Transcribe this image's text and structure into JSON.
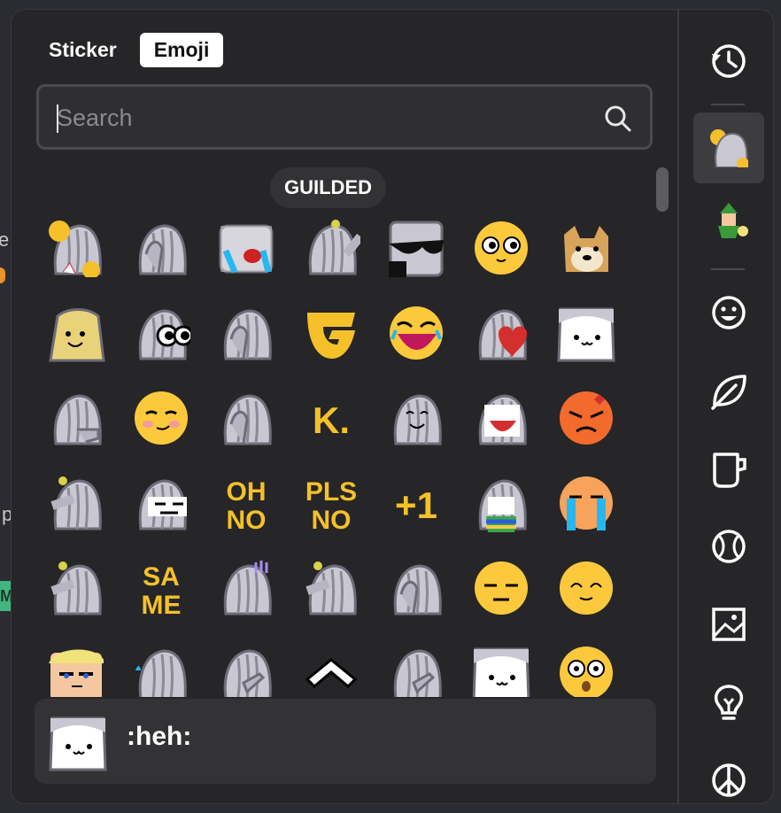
{
  "tabs": {
    "sticker": "Sticker",
    "emoji": "Emoji"
  },
  "search": {
    "placeholder": "Search"
  },
  "section": {
    "title": "GUILDED"
  },
  "preview": {
    "name": ":heh:"
  },
  "background": {
    "peek_letters": [
      "e",
      "p"
    ],
    "badge_letter": "M"
  },
  "rows": [
    [
      {
        "kind": "knight-pompom"
      },
      {
        "kind": "knight-facepalm"
      },
      {
        "kind": "knight-cry"
      },
      {
        "kind": "knight-dab"
      },
      {
        "kind": "knight-shades"
      },
      {
        "kind": "face-pleading"
      },
      {
        "kind": "doge"
      }
    ],
    [
      {
        "kind": "gold-smile"
      },
      {
        "kind": "knight-eyes"
      },
      {
        "kind": "knight-facepalm"
      },
      {
        "kind": "guilded-logo"
      },
      {
        "kind": "face-laugh"
      },
      {
        "kind": "knight-heart"
      },
      {
        "kind": "knight-heh"
      }
    ],
    [
      {
        "kind": "knight-think"
      },
      {
        "kind": "face-smug"
      },
      {
        "kind": "knight-facepalm"
      },
      {
        "kind": "text",
        "text": "K."
      },
      {
        "kind": "knight-smile"
      },
      {
        "kind": "knight-laugh"
      },
      {
        "kind": "face-angry"
      }
    ],
    [
      {
        "kind": "knight-salute"
      },
      {
        "kind": "knight-meh"
      },
      {
        "kind": "text",
        "text": "OH NO"
      },
      {
        "kind": "text",
        "text": "PLS NO"
      },
      {
        "kind": "text",
        "text": "+1"
      },
      {
        "kind": "knight-vomit"
      },
      {
        "kind": "face-sob"
      }
    ],
    [
      {
        "kind": "knight-salute"
      },
      {
        "kind": "text",
        "text": "SA ME"
      },
      {
        "kind": "knight-sweat"
      },
      {
        "kind": "knight-salute"
      },
      {
        "kind": "knight-facepalm"
      },
      {
        "kind": "face-unamused"
      },
      {
        "kind": "face-content"
      }
    ],
    [
      {
        "kind": "blonde-face"
      },
      {
        "kind": "knight-nervous"
      },
      {
        "kind": "knight-point"
      },
      {
        "kind": "chevron"
      },
      {
        "kind": "knight-point"
      },
      {
        "kind": "knight-heh"
      },
      {
        "kind": "face-shock"
      }
    ]
  ],
  "rail": [
    {
      "icon": "recent-clock-icon"
    },
    {
      "icon": "guilded-pack-icon"
    },
    {
      "icon": "zelda-pack-icon"
    },
    {
      "icon": "smileys-icon"
    },
    {
      "icon": "nature-leaf-icon"
    },
    {
      "icon": "food-cup-icon"
    },
    {
      "icon": "activity-ball-icon"
    },
    {
      "icon": "travel-image-icon"
    },
    {
      "icon": "objects-bulb-icon"
    },
    {
      "icon": "symbols-peace-icon"
    }
  ],
  "colors": {
    "panel": "#262628",
    "accent_gold": "#f5c02a",
    "knight_gray": "#c9c7d1",
    "face_yellow": "#fcc93c",
    "angry_orange": "#f26b2c",
    "tear_blue": "#27b7f0"
  }
}
